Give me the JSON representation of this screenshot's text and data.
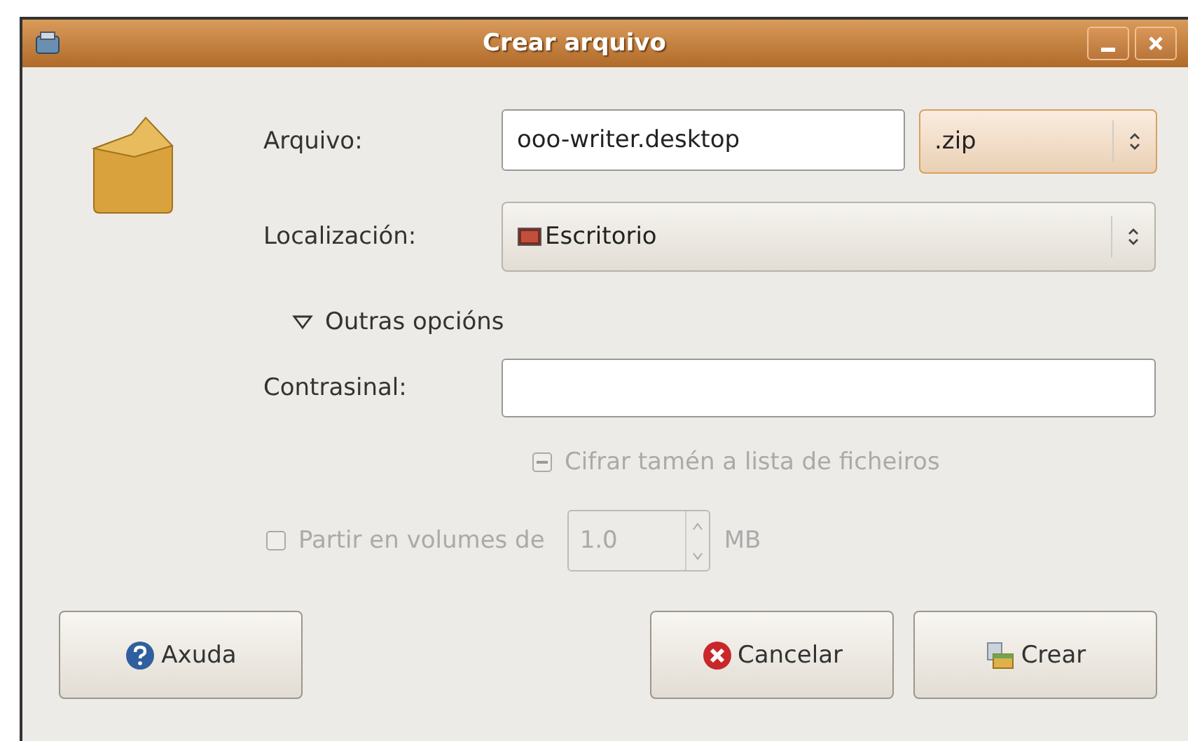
{
  "window": {
    "title": "Crear arquivo"
  },
  "fields": [
    {
      "kind": "entry",
      "label": "Arquivo:",
      "value": "ooo-writer.desktop",
      "combo": ".zip",
      "combo_focused": true
    },
    {
      "kind": "combo",
      "label": "Localización:",
      "value": "Escritorio"
    }
  ],
  "expander": {
    "label": "Outras opcións",
    "expanded": true
  },
  "password": {
    "label": "Contrasinal:"
  },
  "encrypt_list": {
    "label": "Cifrar tamén a lista de ficheiros",
    "inconsistent": true,
    "disabled": true
  },
  "split": {
    "label": "Partir en volumes de",
    "checked": false,
    "disabled": true,
    "value": "1.0",
    "unit": "MB"
  },
  "buttons": [
    {
      "kind": "help",
      "label": "Axuda"
    },
    {
      "kind": "cancel",
      "label": "Cancelar"
    },
    {
      "kind": "create",
      "label": "Crear"
    }
  ]
}
